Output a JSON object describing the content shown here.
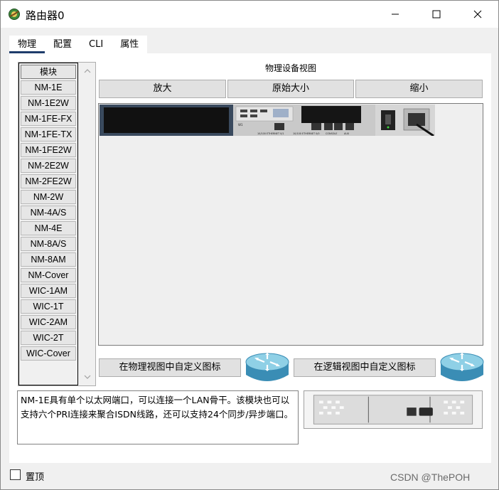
{
  "window": {
    "title": "路由器0",
    "app_icon": "router-app-icon",
    "controls": [
      "minimize-icon",
      "maximize-icon",
      "close-icon"
    ]
  },
  "tabs": [
    {
      "label": "物理",
      "active": true
    },
    {
      "label": "配置",
      "active": false
    },
    {
      "label": "CLI",
      "active": false
    },
    {
      "label": "属性",
      "active": false
    }
  ],
  "modules": {
    "header": "模块",
    "items": [
      "NM-1E",
      "NM-1E2W",
      "NM-1FE-FX",
      "NM-1FE-TX",
      "NM-1FE2W",
      "NM-2E2W",
      "NM-2FE2W",
      "NM-2W",
      "NM-4A/S",
      "NM-4E",
      "NM-8A/S",
      "NM-8AM",
      "NM-Cover",
      "WIC-1AM",
      "WIC-1T",
      "WIC-2AM",
      "WIC-2T",
      "WIC-Cover"
    ]
  },
  "physical_view": {
    "title": "物理设备视图",
    "zoom_in": "放大",
    "original_size": "原始大小",
    "zoom_out": "缩小",
    "device_labels": {
      "port1": "10/100 ETHERNET 0/1",
      "port2": "10/100 ETHERNET 0/0",
      "console": "CONSOLE",
      "aux": "AUX",
      "w1": "W1"
    }
  },
  "custom_icons": {
    "physical": "在物理视图中自定义图标",
    "logical": "在逻辑视图中自定义图标"
  },
  "description": "NM-1E具有单个以太网端口，可以连接一个LAN骨干。该模块也可以支持六个PRI连接来聚合ISDN线路，还可以支持24个同步/异步端口。",
  "footer": {
    "pin_label": "置顶",
    "pin_checked": false,
    "watermark": "CSDN @ThePOH"
  },
  "colors": {
    "tab_underline": "#1f3d6b",
    "router_blue": "#4aa3c7"
  }
}
